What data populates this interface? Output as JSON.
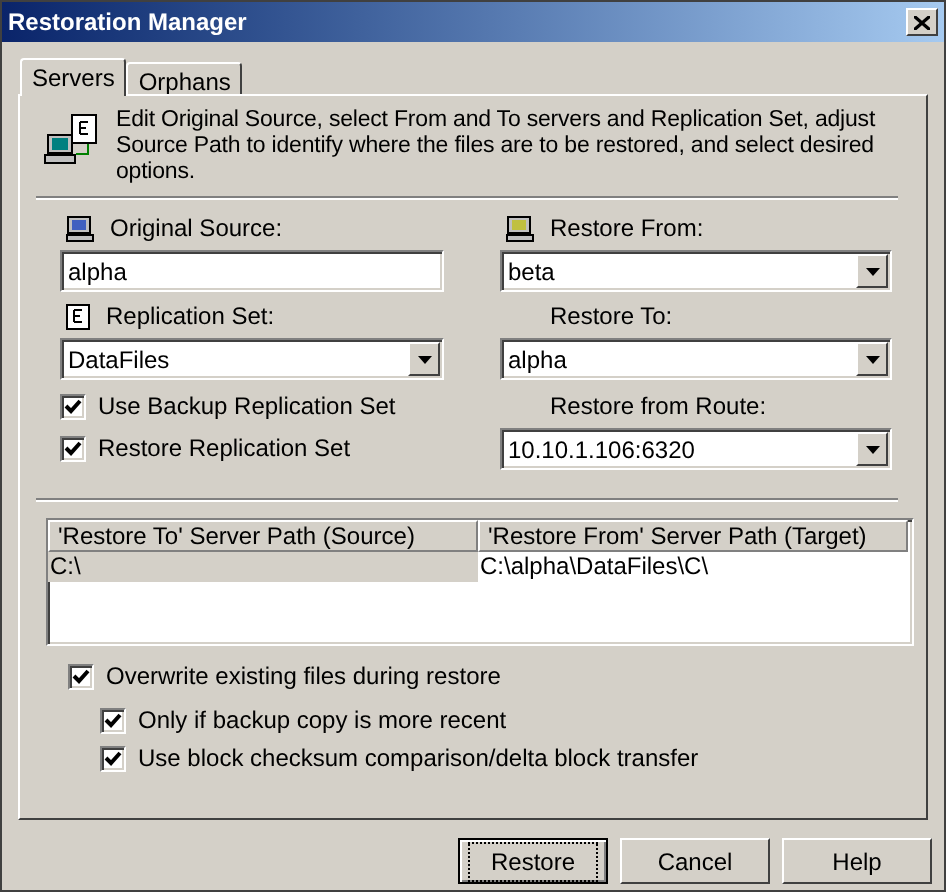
{
  "window": {
    "title": "Restoration Manager"
  },
  "tabs": [
    {
      "label": "Servers",
      "selected": true
    },
    {
      "label": "Orphans",
      "selected": false
    }
  ],
  "description": "Edit Original Source, select From and To servers and Replication Set, adjust Source Path to identify where the files are to be restored, and select desired options.",
  "left": {
    "original_source": {
      "label": "Original Source:",
      "value": "alpha"
    },
    "replication_set": {
      "label": "Replication Set:",
      "value": "DataFiles"
    },
    "checkboxes": [
      {
        "label": "Use Backup Replication Set",
        "checked": true
      },
      {
        "label": "Restore Replication Set",
        "checked": true
      }
    ]
  },
  "right": {
    "restore_from": {
      "label": "Restore From:",
      "value": "beta"
    },
    "restore_to": {
      "label": "Restore To:",
      "value": "alpha"
    },
    "restore_from_route": {
      "label": "Restore from Route:",
      "value": "10.10.1.106:6320"
    }
  },
  "table": {
    "columns": [
      "'Restore To' Server Path (Source)",
      "'Restore From' Server Path (Target)"
    ],
    "rows": [
      {
        "cells": [
          "C:\\",
          "C:\\alpha\\DataFiles\\C\\"
        ],
        "selected": true
      }
    ]
  },
  "options": [
    {
      "label": "Overwrite existing files during restore",
      "checked": true,
      "children": [
        {
          "label": "Only if backup copy is more recent",
          "checked": true
        },
        {
          "label": "Use block checksum comparison/delta block transfer",
          "checked": true
        }
      ]
    }
  ],
  "buttons": [
    {
      "label": "Restore",
      "focused": true
    },
    {
      "label": "Cancel",
      "focused": false
    },
    {
      "label": "Help",
      "focused": false
    }
  ]
}
